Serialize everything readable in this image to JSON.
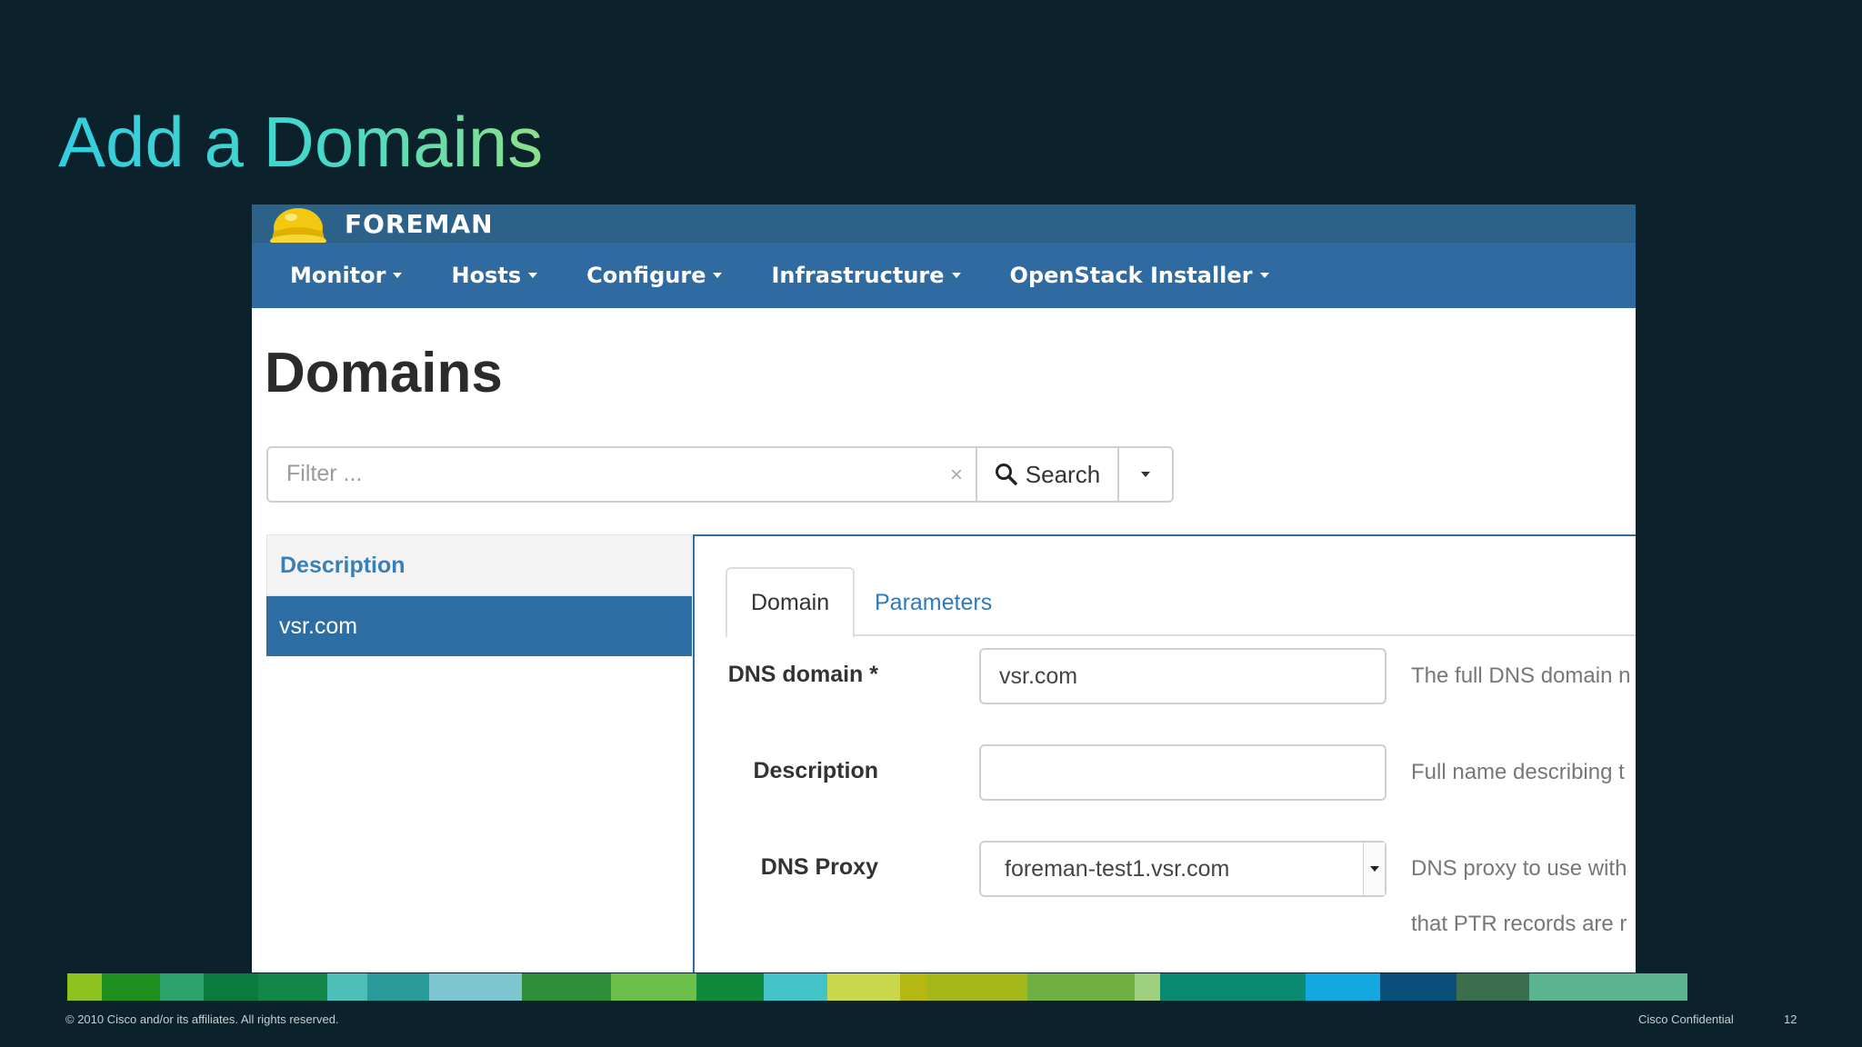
{
  "slide": {
    "title": "Add a Domains",
    "copyright": "© 2010 Cisco and/or its affiliates. All rights reserved.",
    "confidential": "Cisco Confidential",
    "page_number": "12",
    "colorbar_colors": [
      "#8dc21f",
      "#1f8f1f",
      "#2ba36b",
      "#0b7a3d",
      "#13864a",
      "#4cbfb6",
      "#2a9a9a",
      "#7ec6cf",
      "#2f8f38",
      "#6cc04a",
      "#0f8a3c",
      "#44c4c8",
      "#c8d84a",
      "#b4b810",
      "#a4b81a",
      "#6fb040",
      "#9fd080",
      "#0a8a70",
      "#14a8e0",
      "#0a4f7a",
      "#3b6e4c",
      "#5ab490"
    ]
  },
  "app": {
    "brand_name": "FOREMAN",
    "nav": [
      {
        "label": "Monitor"
      },
      {
        "label": "Hosts"
      },
      {
        "label": "Configure"
      },
      {
        "label": "Infrastructure"
      },
      {
        "label": "OpenStack Installer"
      }
    ],
    "page_title": "Domains",
    "search": {
      "placeholder": "Filter ...",
      "value": "",
      "button_label": "Search"
    },
    "list": {
      "header": "Description",
      "rows": [
        "vsr.com"
      ]
    },
    "tabs": [
      {
        "label": "Domain",
        "active": true
      },
      {
        "label": "Parameters",
        "active": false
      }
    ],
    "form": {
      "dns_domain": {
        "label": "DNS domain *",
        "value": "vsr.com",
        "help": "The full DNS domain n"
      },
      "description": {
        "label": "Description",
        "value": "",
        "help": "Full name describing t"
      },
      "dns_proxy": {
        "label": "DNS Proxy",
        "value": "foreman-test1.vsr.com",
        "help": "DNS proxy to use with",
        "help2": "that PTR records are r"
      }
    }
  }
}
